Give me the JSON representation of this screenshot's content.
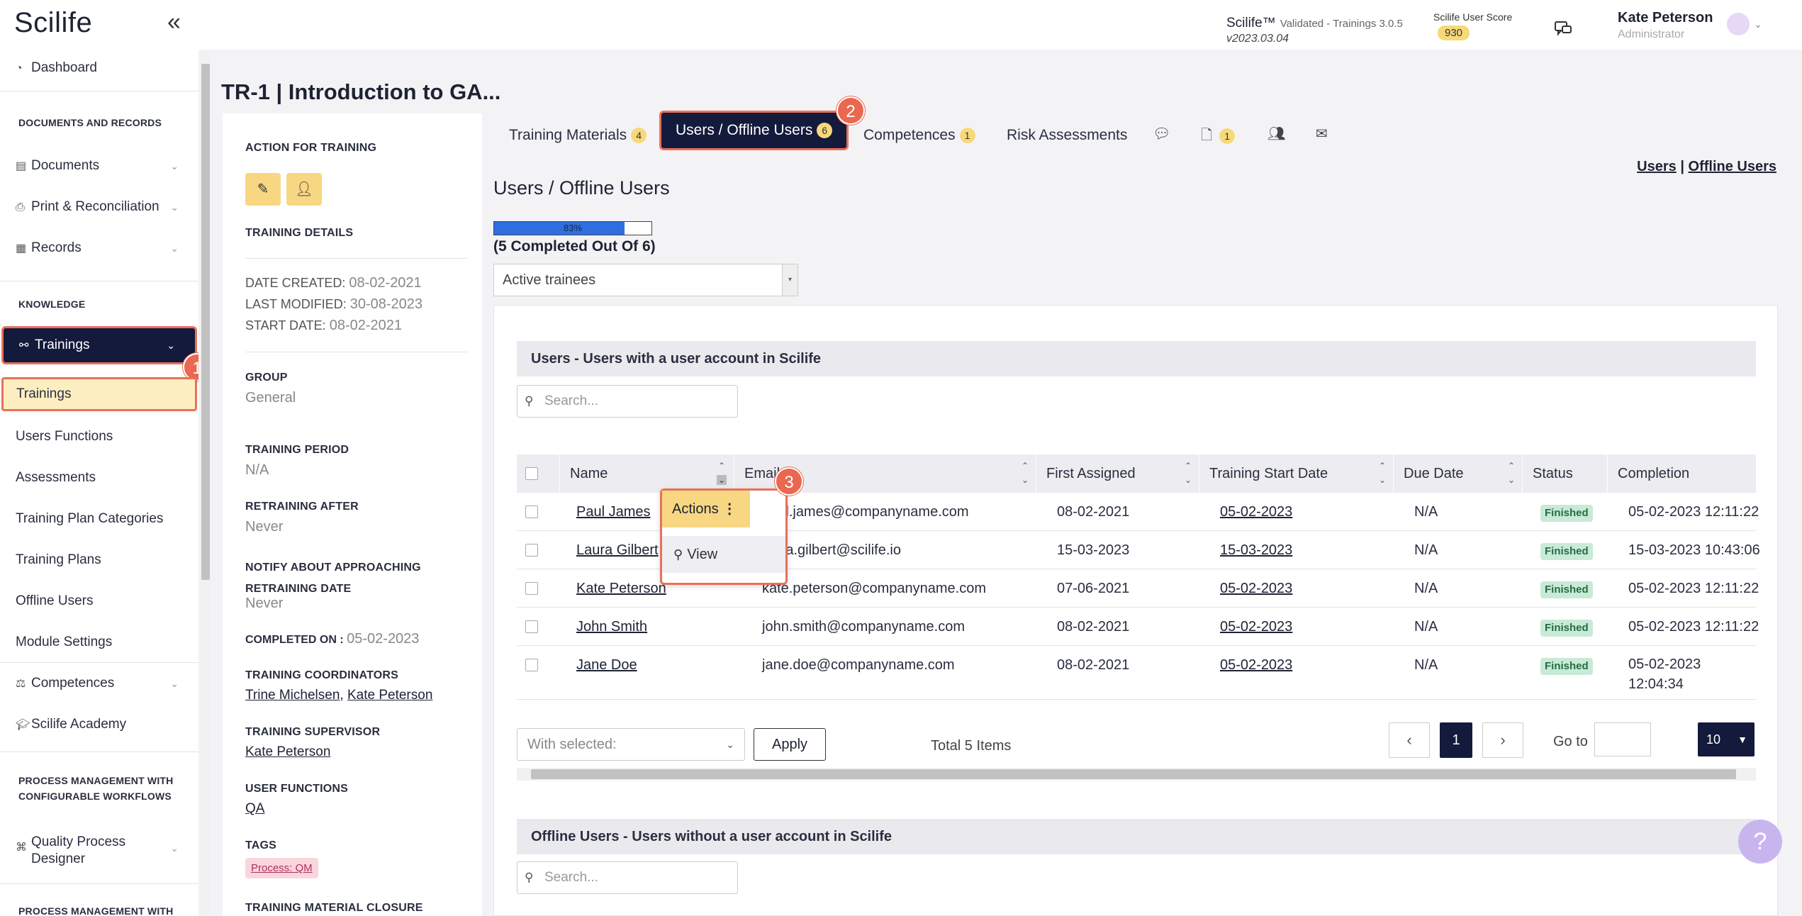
{
  "app": {
    "logo": "Scilife",
    "collapse_icon": "double-chevron-left-icon",
    "brand_name": "Scilife™",
    "brand_validated": "Validated - Trainings 3.0.5",
    "brand_version": "v2023.03.04",
    "score_label": "Scilife User Score",
    "score_value": "930",
    "user_name": "Kate Peterson",
    "user_role": "Administrator",
    "accent_color": "#141a3b",
    "highlight_color": "#e8715a",
    "badge_color": "#f7d97a"
  },
  "sidebar": {
    "dashboard": "Dashboard",
    "section_docs": "DOCUMENTS AND RECORDS",
    "documents": "Documents",
    "print_reconciliation": "Print & Reconciliation",
    "records": "Records",
    "section_knowledge": "KNOWLEDGE",
    "trainings": "Trainings",
    "trainings_sub": "Trainings",
    "users_functions": "Users Functions",
    "assessments": "Assessments",
    "training_plan_categories": "Training Plan Categories",
    "training_plans": "Training Plans",
    "offline_users": "Offline Users",
    "module_settings": "Module Settings",
    "competences": "Competences",
    "scilife_academy": "Scilife Academy",
    "section_process_1a": "PROCESS MANAGEMENT WITH",
    "section_process_1b": "CONFIGURABLE WORKFLOWS",
    "quality_process_designer_a": "Quality Process",
    "quality_process_designer_b": "Designer",
    "section_process_2": "PROCESS MANAGEMENT WITH"
  },
  "steps": {
    "s1": "1",
    "s2": "2",
    "s3": "3"
  },
  "page": {
    "title": "TR-1 | Introduction to GA..."
  },
  "detail": {
    "action_head": "ACTION FOR TRAINING",
    "details_head": "TRAINING DETAILS",
    "date_created_label": "DATE CREATED:",
    "date_created": "08-02-2021",
    "last_modified_label": "LAST MODIFIED:",
    "last_modified": "30-08-2023",
    "start_date_label": "START DATE:",
    "start_date": "08-02-2021",
    "group_head": "GROUP",
    "group": "General",
    "period_head": "TRAINING PERIOD",
    "period": "N/A",
    "retraining_head": "RETRAINING AFTER",
    "retraining": "Never",
    "notify_head_a": "NOTIFY ABOUT APPROACHING",
    "notify_head_b": "RETRAINING DATE",
    "notify": "Never",
    "completed_on_label": "COMPLETED ON :",
    "completed_on": "05-02-2023",
    "coordinators_head": "TRAINING COORDINATORS",
    "coordinator_1": "Trine Michelsen",
    "coordinator_2": "Kate Peterson",
    "supervisor_head": "TRAINING SUPERVISOR",
    "supervisor": "Kate Peterson",
    "functions_head": "USER FUNCTIONS",
    "functions": "QA",
    "tags_head": "TAGS",
    "tag": "Process: QM",
    "closure_head": "TRAINING MATERIAL CLOSURE"
  },
  "tabs": {
    "materials": "Training Materials",
    "materials_count": "4",
    "users": "Users / Offline Users",
    "users_count": "6",
    "competences": "Competences",
    "competences_count": "1",
    "risk": "Risk Assessments",
    "docs_count": "1"
  },
  "main": {
    "section_title": "Users / Offline Users",
    "link_users": "Users",
    "link_sep": "|",
    "link_offline": "Offline Users",
    "progress_percent": 83,
    "progress_label": "83%",
    "completed_text": "(5 Completed Out Of 6)",
    "filter_value": "Active trainees",
    "users_header": "Users - Users with a user account in Scilife",
    "search_placeholder": "Search...",
    "offline_header": "Offline Users - Users without a user account in Scilife"
  },
  "table": {
    "columns": [
      "Name",
      "Email",
      "First Assigned",
      "Training Start Date",
      "Due Date",
      "Status",
      "Completion"
    ],
    "rows": [
      {
        "name": "Paul James",
        "email": "paul.james@companyname.com",
        "first": "08-02-2021",
        "start": "05-02-2023",
        "due": "N/A",
        "status": "Finished",
        "completion": "05-02-2023 12:11:22",
        "completion_2": ""
      },
      {
        "name": "Laura Gilbert",
        "email": "laura.gilbert@scilife.io",
        "first": "15-03-2023",
        "start": "15-03-2023",
        "due": "N/A",
        "status": "Finished",
        "completion": "15-03-2023 10:43:06",
        "completion_2": ""
      },
      {
        "name": "Kate Peterson",
        "email": "kate.peterson@companyname.com",
        "first": "07-06-2021",
        "start": "05-02-2023",
        "due": "N/A",
        "status": "Finished",
        "completion": "05-02-2023 12:11:22",
        "completion_2": ""
      },
      {
        "name": "John Smith",
        "email": "john.smith@companyname.com",
        "first": "08-02-2021",
        "start": "05-02-2023",
        "due": "N/A",
        "status": "Finished",
        "completion": "05-02-2023 12:11:22",
        "completion_2": ""
      },
      {
        "name": "Jane Doe",
        "email": "jane.doe@companyname.com",
        "first": "08-02-2021",
        "start": "05-02-2023",
        "due": "N/A",
        "status": "Finished",
        "completion": "05-02-2023",
        "completion_2": "12:04:34"
      }
    ],
    "actions_label": "Actions",
    "view_label": "View",
    "with_selected": "With selected:",
    "apply": "Apply",
    "total": "Total 5 Items",
    "current_page": "1",
    "goto_label": "Go to",
    "per_page": "10"
  },
  "help": {
    "label": "?"
  }
}
